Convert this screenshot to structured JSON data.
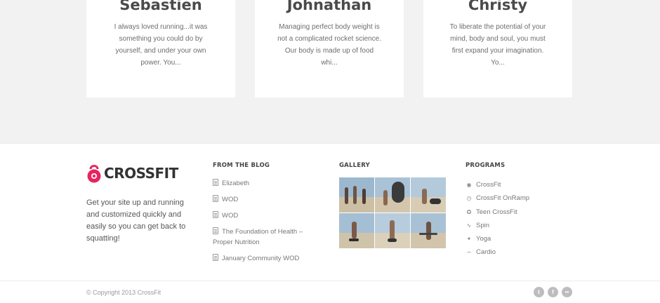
{
  "testimonials": [
    {
      "name": "Sebastien",
      "text": "I always loved running...it was something you could do by yourself, and under your own power. You..."
    },
    {
      "name": "Johnathan",
      "text": "Managing perfect body weight is not a complicated rocket science. Our body is made up of food whi..."
    },
    {
      "name": "Christy",
      "text": "To liberate the potential of your mind, body and soul, you must first expand your imagination. Yo..."
    }
  ],
  "footer": {
    "logo_text": "CROSSFIT",
    "about": "Get your site up and running and customized quickly and easily so you can get back to squatting!",
    "blog": {
      "heading": "FROM THE BLOG",
      "items": [
        "Elizabeth",
        "WOD",
        "WOD",
        "The Foundation of Health – Proper Nutrition",
        "January Community WOD"
      ]
    },
    "gallery": {
      "heading": "GALLERY"
    },
    "programs": {
      "heading": "PROGRAMS",
      "items": [
        {
          "label": "CrossFit",
          "icon": "kettlebell-icon"
        },
        {
          "label": "CrossFit OnRamp",
          "icon": "stopwatch-icon"
        },
        {
          "label": "Teen CrossFit",
          "icon": "person-icon"
        },
        {
          "label": "Spin",
          "icon": "bike-icon"
        },
        {
          "label": "Yoga",
          "icon": "yoga-icon"
        },
        {
          "label": "Cardio",
          "icon": "heartbeat-icon"
        }
      ]
    },
    "copyright": "© Copyright 2013 CrossFit",
    "social": [
      {
        "icon": "twitter-icon",
        "glyph": "t"
      },
      {
        "icon": "facebook-icon",
        "glyph": "f"
      },
      {
        "icon": "flickr-icon",
        "glyph": "••"
      }
    ]
  },
  "colors": {
    "brand": "#e8235f",
    "text": "#555555",
    "muted": "#999999"
  }
}
